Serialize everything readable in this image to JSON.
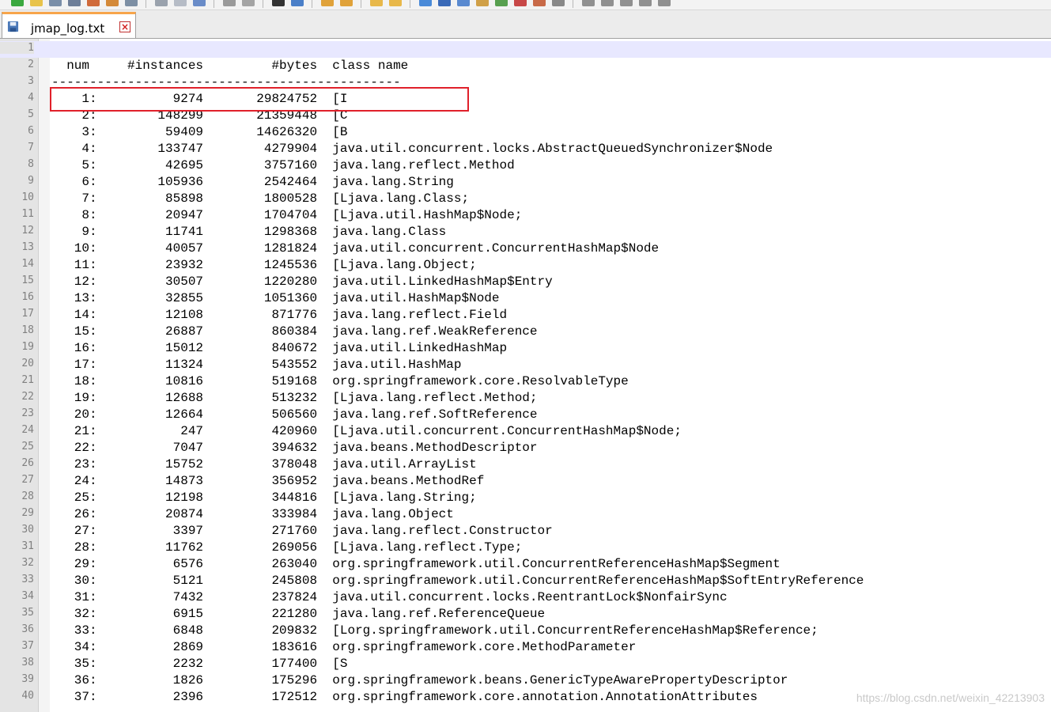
{
  "tab": {
    "filename": "jmap_log.txt",
    "close_glyph": "×"
  },
  "current_line": 1,
  "lines": [
    "",
    "  num     #instances         #bytes  class name",
    "----------------------------------------------",
    "    1:          9274       29824752  [I",
    "    2:        148299       21359448  [C",
    "    3:         59409       14626320  [B",
    "    4:        133747        4279904  java.util.concurrent.locks.AbstractQueuedSynchronizer$Node",
    "    5:         42695        3757160  java.lang.reflect.Method",
    "    6:        105936        2542464  java.lang.String",
    "    7:         85898        1800528  [Ljava.lang.Class;",
    "    8:         20947        1704704  [Ljava.util.HashMap$Node;",
    "    9:         11741        1298368  java.lang.Class",
    "   10:         40057        1281824  java.util.concurrent.ConcurrentHashMap$Node",
    "   11:         23932        1245536  [Ljava.lang.Object;",
    "   12:         30507        1220280  java.util.LinkedHashMap$Entry",
    "   13:         32855        1051360  java.util.HashMap$Node",
    "   14:         12108         871776  java.lang.reflect.Field",
    "   15:         26887         860384  java.lang.ref.WeakReference",
    "   16:         15012         840672  java.util.LinkedHashMap",
    "   17:         11324         543552  java.util.HashMap",
    "   18:         10816         519168  org.springframework.core.ResolvableType",
    "   19:         12688         513232  [Ljava.lang.reflect.Method;",
    "   20:         12664         506560  java.lang.ref.SoftReference",
    "   21:           247         420960  [Ljava.util.concurrent.ConcurrentHashMap$Node;",
    "   22:          7047         394632  java.beans.MethodDescriptor",
    "   23:         15752         378048  java.util.ArrayList",
    "   24:         14873         356952  java.beans.MethodRef",
    "   25:         12198         344816  [Ljava.lang.String;",
    "   26:         20874         333984  java.lang.Object",
    "   27:          3397         271760  java.lang.reflect.Constructor",
    "   28:         11762         269056  [Ljava.lang.reflect.Type;",
    "   29:          6576         263040  org.springframework.util.ConcurrentReferenceHashMap$Segment",
    "   30:          5121         245808  org.springframework.util.ConcurrentReferenceHashMap$SoftEntryReference",
    "   31:          7432         237824  java.util.concurrent.locks.ReentrantLock$NonfairSync",
    "   32:          6915         221280  java.lang.ref.ReferenceQueue",
    "   33:          6848         209832  [Lorg.springframework.util.ConcurrentReferenceHashMap$Reference;",
    "   34:          2869         183616  org.springframework.core.MethodParameter",
    "   35:          2232         177400  [S",
    "   36:          1826         175296  org.springframework.beans.GenericTypeAwarePropertyDescriptor",
    "   37:          2396         172512  org.springframework.core.annotation.AnnotationAttributes"
  ],
  "watermark": "https://blog.csdn.net/weixin_42213903"
}
